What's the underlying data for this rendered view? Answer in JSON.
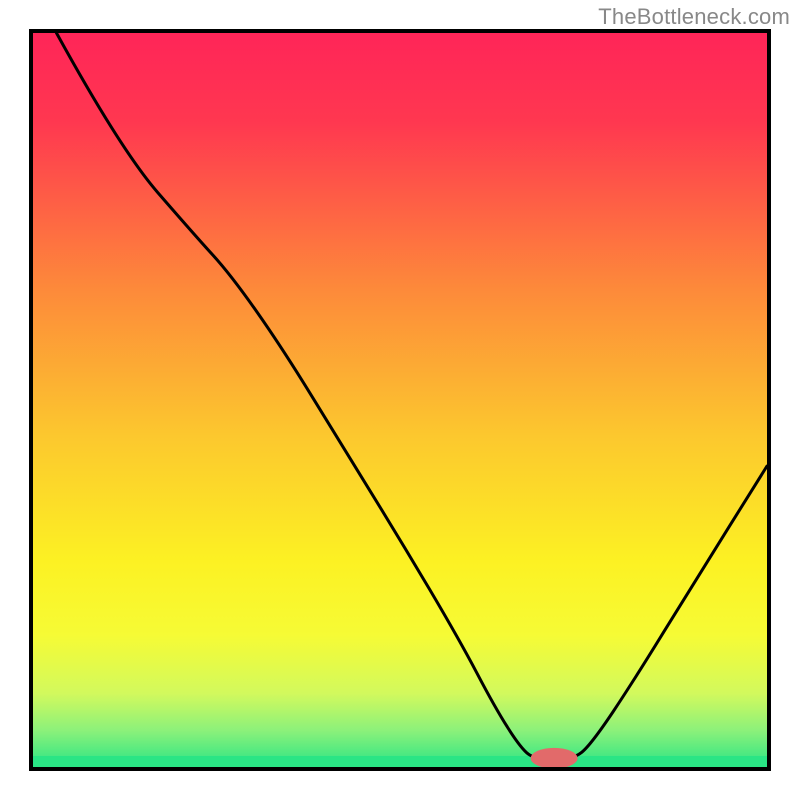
{
  "watermark": "TheBottleneck.com",
  "chart_data": {
    "type": "line",
    "title": "",
    "xlabel": "",
    "ylabel": "",
    "xlim": [
      0,
      100
    ],
    "ylim": [
      0,
      100
    ],
    "background_gradient": {
      "stops": [
        {
          "offset": 0.0,
          "color": "#ff2558"
        },
        {
          "offset": 0.12,
          "color": "#ff3750"
        },
        {
          "offset": 0.35,
          "color": "#fd8a3a"
        },
        {
          "offset": 0.55,
          "color": "#fcc82e"
        },
        {
          "offset": 0.72,
          "color": "#fcf123"
        },
        {
          "offset": 0.82,
          "color": "#f6fb35"
        },
        {
          "offset": 0.9,
          "color": "#d2f95d"
        },
        {
          "offset": 0.95,
          "color": "#8cf17a"
        },
        {
          "offset": 1.0,
          "color": "#2ae585"
        }
      ]
    },
    "green_strip_y_fraction": 0.985,
    "marker": {
      "x": 71,
      "y": 1.2,
      "rx": 3.2,
      "ry": 1.4,
      "color": "#e26a6a"
    },
    "series": [
      {
        "name": "bottleneck-curve",
        "points": [
          {
            "x": 3.2,
            "y": 100.0
          },
          {
            "x": 12.0,
            "y": 84.0
          },
          {
            "x": 22.0,
            "y": 72.5
          },
          {
            "x": 27.0,
            "y": 67.0
          },
          {
            "x": 34.0,
            "y": 57.0
          },
          {
            "x": 42.0,
            "y": 44.0
          },
          {
            "x": 50.0,
            "y": 31.0
          },
          {
            "x": 58.0,
            "y": 17.5
          },
          {
            "x": 63.0,
            "y": 8.0
          },
          {
            "x": 66.5,
            "y": 2.5
          },
          {
            "x": 68.5,
            "y": 1.0
          },
          {
            "x": 73.5,
            "y": 1.0
          },
          {
            "x": 76.0,
            "y": 3.0
          },
          {
            "x": 82.0,
            "y": 12.0
          },
          {
            "x": 90.0,
            "y": 25.0
          },
          {
            "x": 100.0,
            "y": 41.0
          }
        ]
      }
    ]
  }
}
